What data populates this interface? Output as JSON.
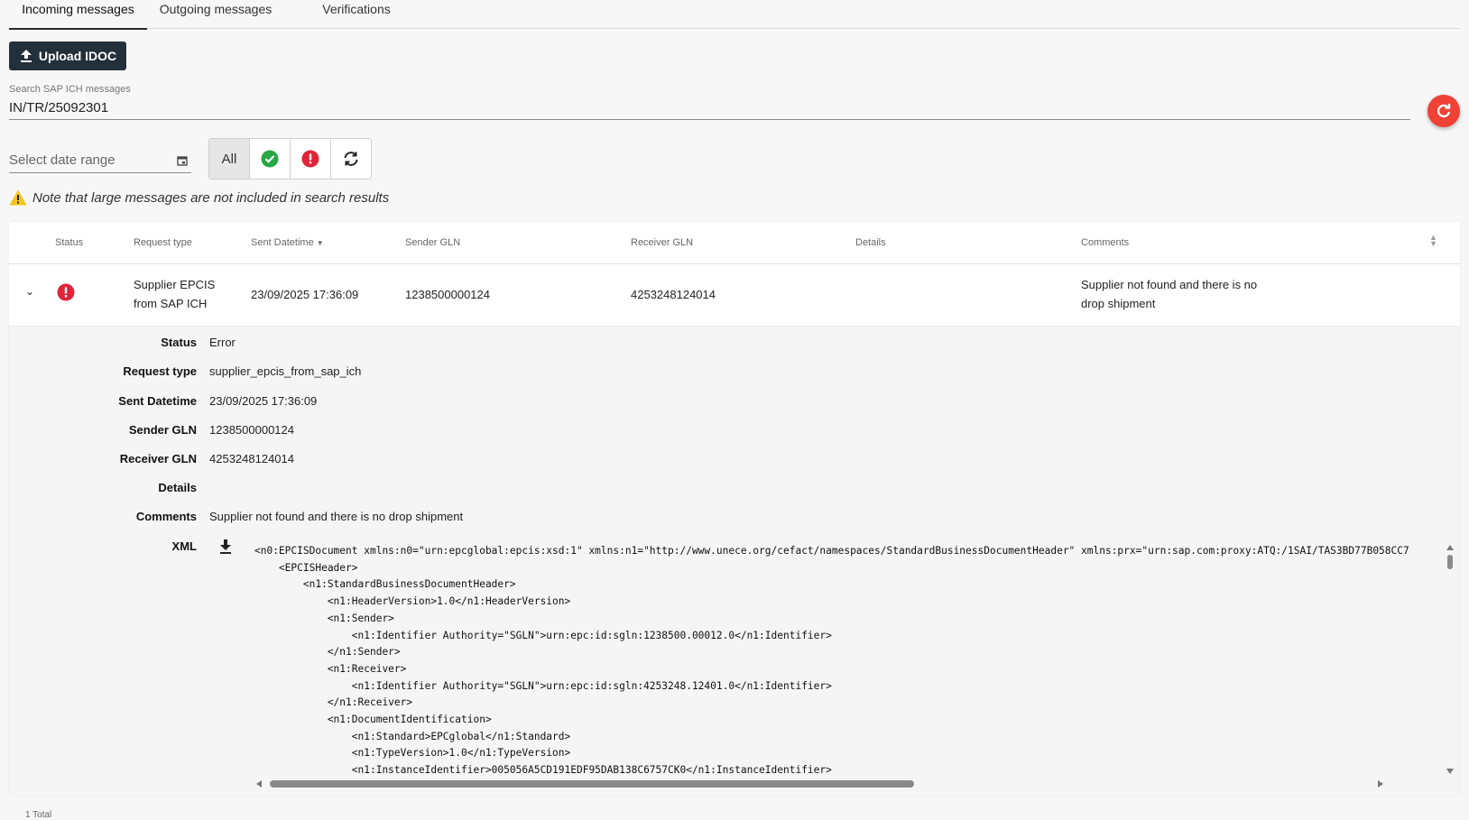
{
  "tabs": [
    {
      "label": "Incoming messages",
      "active": true
    },
    {
      "label": "Outgoing messages",
      "active": false
    },
    {
      "label": "Verifications",
      "active": false
    }
  ],
  "upload_button": "Upload IDOC",
  "search": {
    "label": "Search SAP ICH messages",
    "value": "IN/TR/25092301"
  },
  "date_range": {
    "placeholder": "Select date range"
  },
  "filters": {
    "all_label": "All"
  },
  "note": "Note that large messages are not included in search results",
  "table": {
    "headers": {
      "status": "Status",
      "request_type": "Request type",
      "sent_datetime": "Sent Datetime",
      "sender_gln": "Sender GLN",
      "receiver_gln": "Receiver GLN",
      "details": "Details",
      "comments": "Comments"
    },
    "row": {
      "request_type_line1": "Supplier EPCIS",
      "request_type_line2": "from SAP ICH",
      "sent_datetime": "23/09/2025 17:36:09",
      "sender_gln": "1238500000124",
      "receiver_gln": "4253248124014",
      "comment_line1": "Supplier not found and there is no",
      "comment_line2": "drop shipment"
    },
    "detail": {
      "status_label": "Status",
      "status": "Error",
      "request_type_label": "Request type",
      "request_type": "supplier_epcis_from_sap_ich",
      "sent_label": "Sent Datetime",
      "sent": "23/09/2025 17:36:09",
      "sender_label": "Sender GLN",
      "sender": "1238500000124",
      "receiver_label": "Receiver GLN",
      "receiver": "4253248124014",
      "details_label": "Details",
      "details": "",
      "comments_label": "Comments",
      "comments": "Supplier not found and there is no drop shipment",
      "xml_label": "XML",
      "xml": "<n0:EPCISDocument xmlns:n0=\"urn:epcglobal:epcis:xsd:1\" xmlns:n1=\"http://www.unece.org/cefact/namespaces/StandardBusinessDocumentHeader\" xmlns:prx=\"urn:sap.com:proxy:ATQ:/1SAI/TAS3BD77B058CC7\n    <EPCISHeader>\n        <n1:StandardBusinessDocumentHeader>\n            <n1:HeaderVersion>1.0</n1:HeaderVersion>\n            <n1:Sender>\n                <n1:Identifier Authority=\"SGLN\">urn:epc:id:sgln:1238500.00012.0</n1:Identifier>\n            </n1:Sender>\n            <n1:Receiver>\n                <n1:Identifier Authority=\"SGLN\">urn:epc:id:sgln:4253248.12401.0</n1:Identifier>\n            </n1:Receiver>\n            <n1:DocumentIdentification>\n                <n1:Standard>EPCglobal</n1:Standard>\n                <n1:TypeVersion>1.0</n1:TypeVersion>\n                <n1:InstanceIdentifier>005056A5CD191EDF95DAB138C6757CK0</n1:InstanceIdentifier>"
    }
  },
  "footer": {
    "total": "1 Total"
  },
  "colors": {
    "error": "#e0243a",
    "success": "#28a745",
    "fab": "#ef4136",
    "button": "#22303c"
  }
}
